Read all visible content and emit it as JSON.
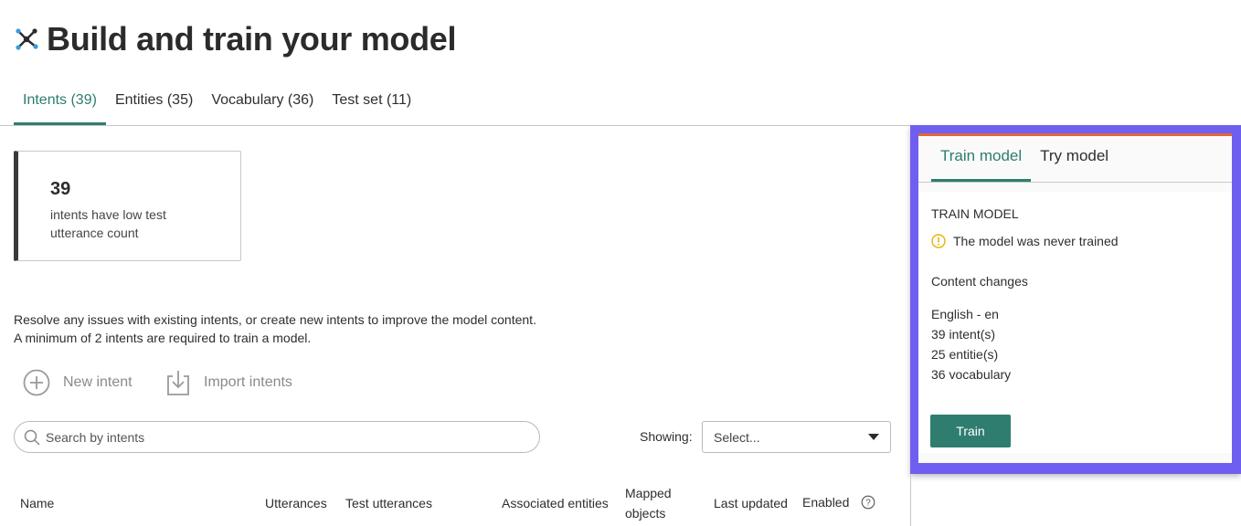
{
  "header": {
    "title": "Build and train your model",
    "icon": "model-network-icon"
  },
  "tabs": [
    {
      "label": "Intents (39)",
      "active": true
    },
    {
      "label": "Entities (35)",
      "active": false
    },
    {
      "label": "Vocabulary (36)",
      "active": false
    },
    {
      "label": "Test set (11)",
      "active": false
    }
  ],
  "stat_card": {
    "number": "39",
    "label": "intents have low test utterance count"
  },
  "info": {
    "line1": "Resolve any issues with existing intents, or create new intents to improve the model content.",
    "line2": "A minimum of 2 intents are required to train a model."
  },
  "actions": {
    "new_intent": "New intent",
    "import_intents": "Import intents"
  },
  "search": {
    "placeholder": "Search by intents",
    "value": ""
  },
  "filter": {
    "showing_label": "Showing:",
    "select_value": "Select..."
  },
  "table": {
    "columns": [
      "Name",
      "Utterances",
      "Test utterances",
      "Associated entities",
      "Mapped objects",
      "Last updated",
      "Enabled"
    ]
  },
  "panel": {
    "tabs": [
      {
        "label": "Train model",
        "active": true
      },
      {
        "label": "Try model",
        "active": false
      }
    ],
    "heading": "TRAIN MODEL",
    "warning": "The model was never trained",
    "changes_title": "Content changes",
    "changes": [
      "English - en",
      "39 intent(s)",
      "25 entitie(s)",
      "36 vocabulary"
    ],
    "train_button": "Train"
  },
  "colors": {
    "accent": "#2e7d6e",
    "highlight": "#6f5ff0",
    "warning": "#e8b400"
  }
}
